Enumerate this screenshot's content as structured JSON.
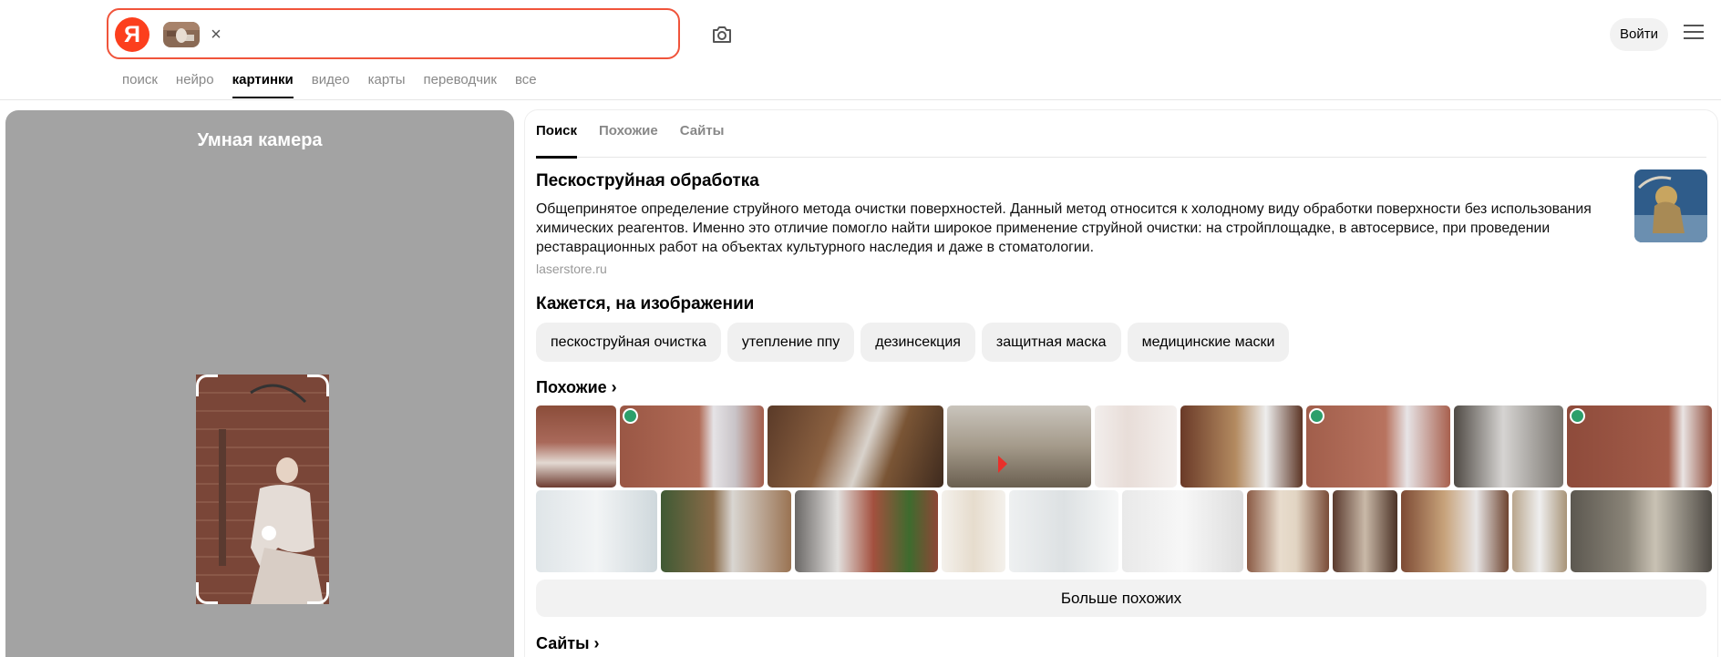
{
  "header": {
    "logo_letter": "Я",
    "chip_close": "×",
    "login_label": "Войти"
  },
  "nav": [
    "поиск",
    "нейро",
    "картинки",
    "видео",
    "карты",
    "переводчик",
    "все"
  ],
  "left_panel": {
    "title": "Умная камера"
  },
  "tabs": [
    "Поиск",
    "Похожие",
    "Сайты"
  ],
  "article": {
    "title": "Пескоструйная обработка",
    "text": "Общепринятое определение струйного метода очистки поверхностей. Данный метод относится к холодному виду обработки поверхности без использования химических реагентов. Именно это отличие помогло найти широкое применение струйной очистки: на стройплощадке, в автосервисе, при проведении реставрационных работ на объектах культурного наследия и даже в стоматологии.",
    "source": "laserstore.ru"
  },
  "tags_section": {
    "title": "Кажется, на изображении",
    "tags": [
      "пескоструйная очистка",
      "утепление ппу",
      "дезинсекция",
      "защитная маска",
      "медицинские маски"
    ]
  },
  "similar": {
    "title": "Похожие ›",
    "more_label": "Больше похожих"
  },
  "sites": {
    "title": "Сайты ›"
  },
  "colors": {
    "accent": "#fc3f1d",
    "search_border": "#f0543b",
    "panel_gray": "#a3a3a3"
  },
  "icons": [
    "camera-icon",
    "menu-icon",
    "close-icon",
    "chevron-right-icon"
  ]
}
